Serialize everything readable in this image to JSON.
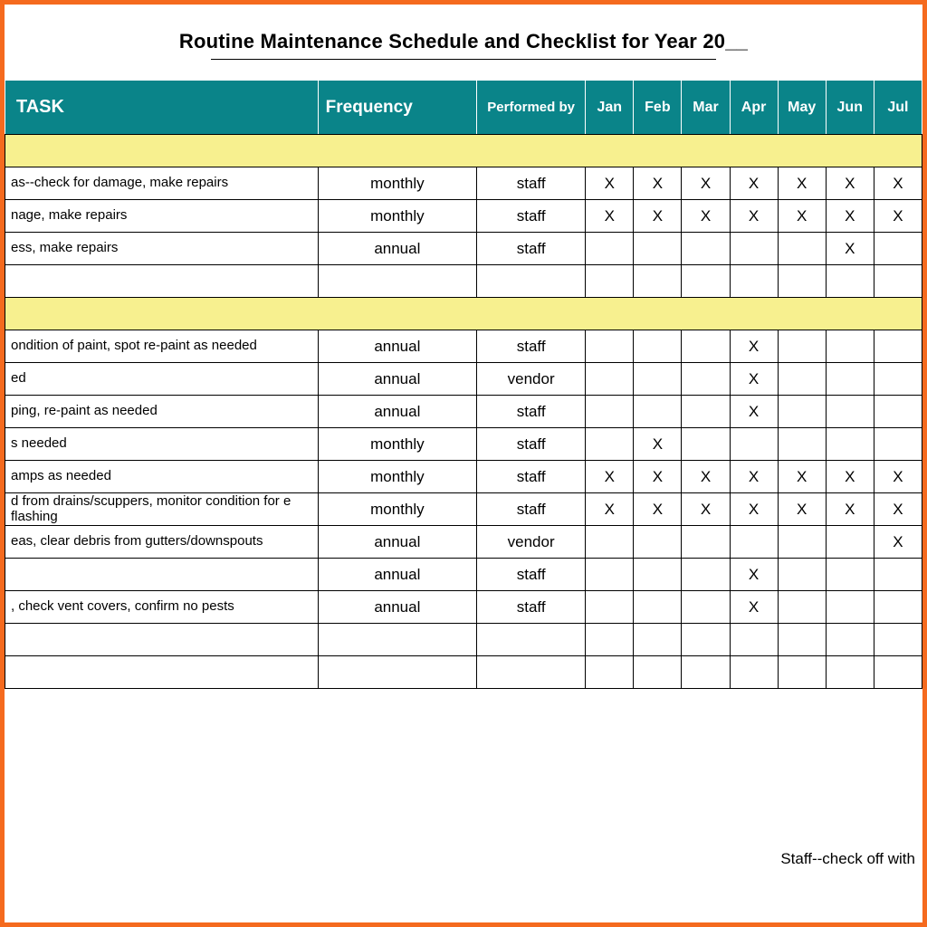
{
  "title": "Routine Maintenance Schedule and Checklist for Year 20__",
  "headers": {
    "task": "TASK",
    "frequency": "Frequency",
    "performed": "Performed by",
    "months": [
      "Jan",
      "Feb",
      "Mar",
      "Apr",
      "May",
      "Jun",
      "Jul"
    ]
  },
  "groups": [
    {
      "rows": [
        {
          "task": "as--check for damage, make repairs",
          "freq": "monthly",
          "perf": "staff",
          "months": [
            "X",
            "X",
            "X",
            "X",
            "X",
            "X",
            "X"
          ]
        },
        {
          "task": "nage, make repairs",
          "freq": "monthly",
          "perf": "staff",
          "months": [
            "X",
            "X",
            "X",
            "X",
            "X",
            "X",
            "X"
          ]
        },
        {
          "task": "ess, make repairs",
          "freq": "annual",
          "perf": "staff",
          "months": [
            "",
            "",
            "",
            "",
            "",
            "X",
            ""
          ]
        },
        {
          "task": "",
          "freq": "",
          "perf": "",
          "months": [
            "",
            "",
            "",
            "",
            "",
            "",
            ""
          ]
        }
      ]
    },
    {
      "rows": [
        {
          "task": "ondition of paint, spot re-paint as needed",
          "freq": "annual",
          "perf": "staff",
          "months": [
            "",
            "",
            "",
            "X",
            "",
            "",
            ""
          ]
        },
        {
          "task": "ed",
          "freq": "annual",
          "perf": "vendor",
          "months": [
            "",
            "",
            "",
            "X",
            "",
            "",
            ""
          ]
        },
        {
          "task": "ping, re-paint as needed",
          "freq": "annual",
          "perf": "staff",
          "months": [
            "",
            "",
            "",
            "X",
            "",
            "",
            ""
          ]
        },
        {
          "task": "s needed",
          "freq": "monthly",
          "perf": "staff",
          "months": [
            "",
            "X",
            "",
            "",
            "",
            "",
            ""
          ]
        },
        {
          "task": "amps as needed",
          "freq": "monthly",
          "perf": "staff",
          "months": [
            "X",
            "X",
            "X",
            "X",
            "X",
            "X",
            "X"
          ]
        },
        {
          "task": "d from drains/scuppers, monitor condition for e flashing",
          "freq": "monthly",
          "perf": "staff",
          "months": [
            "X",
            "X",
            "X",
            "X",
            "X",
            "X",
            "X"
          ]
        },
        {
          "task": "eas, clear debris from gutters/downspouts",
          "freq": "annual",
          "perf": "vendor",
          "months": [
            "",
            "",
            "",
            "",
            "",
            "",
            "X"
          ]
        },
        {
          "task": "",
          "freq": "annual",
          "perf": "staff",
          "months": [
            "",
            "",
            "",
            "X",
            "",
            "",
            ""
          ]
        },
        {
          "task": ", check vent covers, confirm no pests",
          "freq": "annual",
          "perf": "staff",
          "months": [
            "",
            "",
            "",
            "X",
            "",
            "",
            ""
          ]
        },
        {
          "task": "",
          "freq": "",
          "perf": "",
          "months": [
            "",
            "",
            "",
            "",
            "",
            "",
            ""
          ]
        },
        {
          "task": "",
          "freq": "",
          "perf": "",
          "months": [
            "",
            "",
            "",
            "",
            "",
            "",
            ""
          ]
        }
      ]
    }
  ],
  "footer": "Staff--check off with"
}
